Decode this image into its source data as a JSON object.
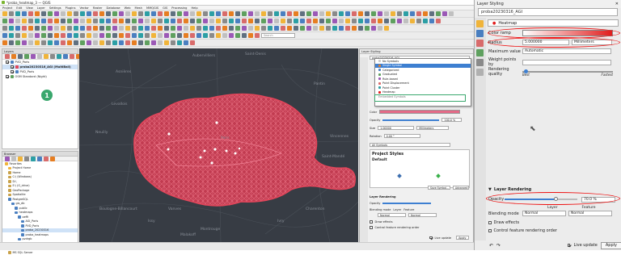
{
  "window": {
    "title": "*proba_heatmap_3 — QGIS"
  },
  "menu": [
    "Project",
    "Edit",
    "View",
    "Layer",
    "Settings",
    "Plugins",
    "Vector",
    "Raster",
    "Database",
    "Web",
    "Mesh",
    "MMQGIS",
    "GIS",
    "Processing",
    "Help"
  ],
  "search": {
    "placeholder": "Search"
  },
  "layers_panel": {
    "title": "Layers",
    "items": [
      "PVD_Paris",
      "proba20230316_AGI (MultiBall)",
      "PVD_Paris",
      "OSM Standard (Night)"
    ]
  },
  "callout_number": "1",
  "browser_panel": {
    "title": "Browser",
    "items": [
      "Favorites",
      "Project Home",
      "Home",
      "C:\\ (Windows)",
      "D:\\",
      "E:\\ (G_drive)",
      "GeoPackage",
      "Spatialite",
      "PostgreSQL",
      "gis_db",
      "public",
      "heatmaps",
      "oeffi",
      "AGI_Paris",
      "PVD_Paris",
      "proba_20230316",
      "proba_heatmaps",
      "pvdrgb",
      "public",
      "SAP HANA",
      "MS SQL Server"
    ]
  },
  "map_labels": [
    "Aubervilliers",
    "Saint-Denis",
    "Asnières",
    "Pantin",
    "Levallois",
    "Neuilly",
    "Paris",
    "Boulogne-Billancourt",
    "Montrouge",
    "Ivry",
    "Issy",
    "Vanves",
    "Malakoff",
    "Vincennes",
    "Saint-Mandé",
    "Charenton"
  ],
  "layer_styling_small": {
    "title": "Layer Styling",
    "layer": "proba20230316_AGI",
    "renderer_options": [
      "No Symbols",
      "Single Symbol",
      "Categorized",
      "Graduated",
      "Rule-based",
      "Point Displacement",
      "Point Cluster",
      "Heatmap"
    ],
    "selected_option": "Single Symbol",
    "highlighted_option": "Heatmap",
    "extra": "Embedded Symbols",
    "rows": {
      "color_label": "Color",
      "opacity_label": "Opacity",
      "opacity_value": "100.0 %",
      "size_label": "Size",
      "size_value": "1.00000",
      "size_unit": "Millimeters",
      "rotation_label": "Rotation",
      "rotation_value": "0.00 °"
    },
    "symbols_label": "All Symbols",
    "project_styles": "Project Styles",
    "default_label": "Default",
    "save_symbol": "Save Symbol...",
    "advanced": "Advanced",
    "layer_rendering": "Layer Rendering",
    "opacity": "Opacity",
    "blending_mode": "Blending mode",
    "blend_layer": "Layer",
    "blend_feature": "Feature",
    "normal": "Normal",
    "draw_effects": "Draw effects",
    "control_order": "Control feature rendering order",
    "live_update": "Live update",
    "apply": "Apply",
    "tabs": [
      "Layer Styling",
      "Processing Toolbox"
    ]
  },
  "layer_styling": {
    "title": "Layer Styling",
    "layer": "proba20230316_AGI",
    "renderer": "Heatmap",
    "color_ramp_label": "Color ramp",
    "radius_label": "Radius",
    "radius_value": "5.000000",
    "radius_unit": "Millimeters",
    "max_value_label": "Maximum value",
    "max_value": "Automatic",
    "weight_label": "Weight points by",
    "quality_label": "Rendering quality",
    "quality_low": "Best",
    "quality_high": "Fastest",
    "layer_rendering": "Layer Rendering",
    "opacity_label": "Opacity",
    "opacity_value": "70.0 %",
    "opacity_fraction": 0.7,
    "blending_label": "Blending mode",
    "blend_layer_label": "Layer",
    "blend_feature_label": "Feature",
    "blend_layer_value": "Normal",
    "blend_feature_value": "Normal",
    "draw_effects": "Draw effects",
    "control_order": "Control feature rendering order",
    "live_update": "Live update",
    "apply": "Apply"
  },
  "colors": {
    "accent": "#e11d1d",
    "heat": "#e2455a",
    "map_bg": "#373c44",
    "green": "#3aa76d"
  }
}
